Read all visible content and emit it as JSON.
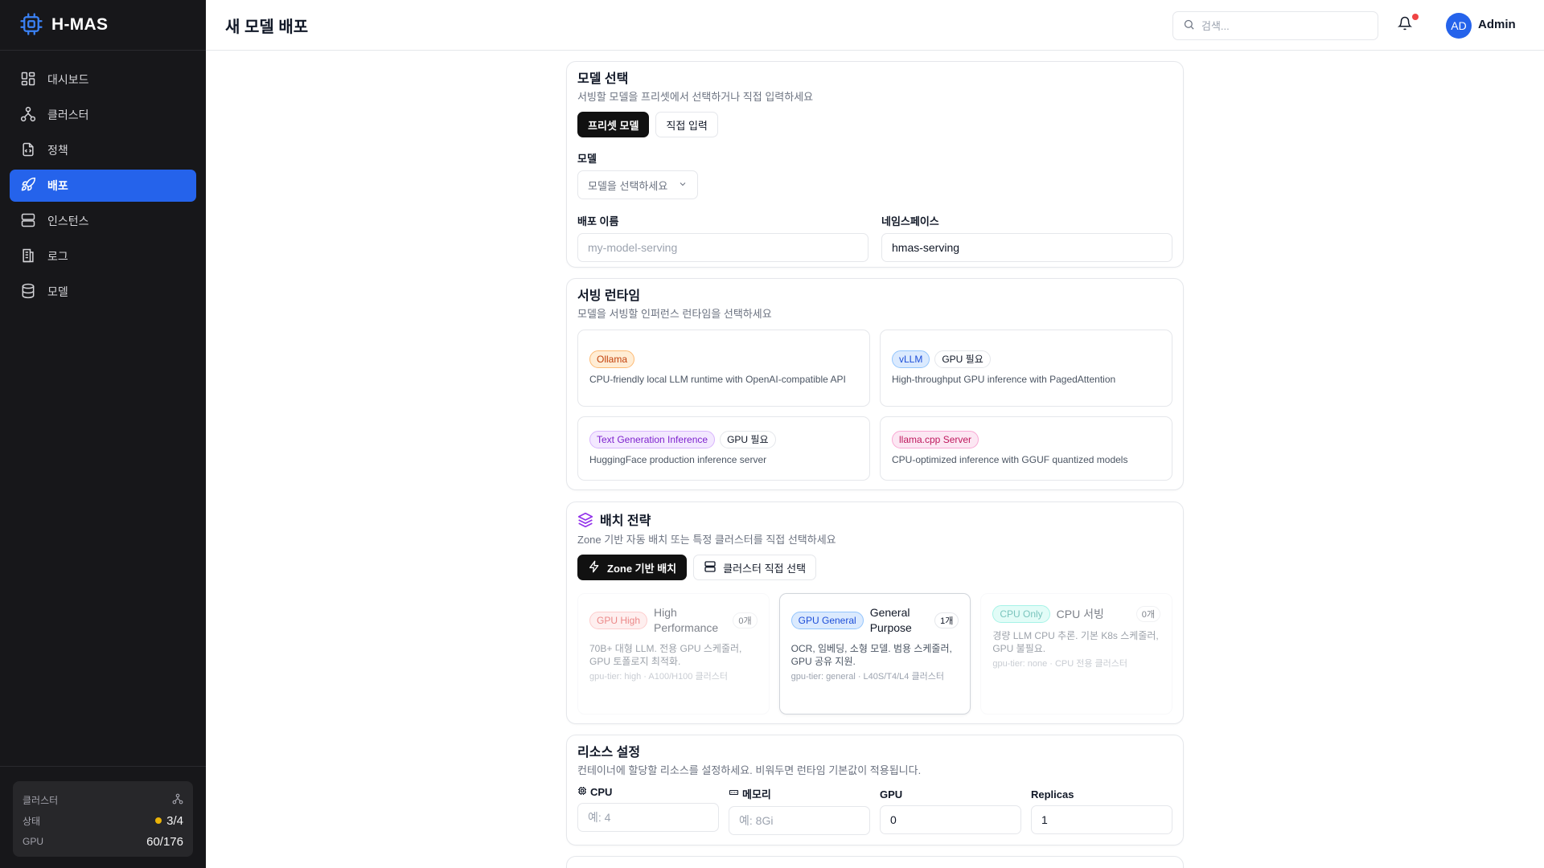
{
  "app": {
    "name": "H-MAS",
    "page_title": "새 모델 배포"
  },
  "sidebar": {
    "items": [
      {
        "label": "대시보드",
        "icon": "dashboard-icon"
      },
      {
        "label": "클러스터",
        "icon": "cluster-icon"
      },
      {
        "label": "정책",
        "icon": "policy-icon"
      },
      {
        "label": "배포",
        "icon": "rocket-icon",
        "active": true
      },
      {
        "label": "인스턴스",
        "icon": "server-icon"
      },
      {
        "label": "로그",
        "icon": "log-icon"
      },
      {
        "label": "모델",
        "icon": "database-icon"
      }
    ],
    "cluster_card": {
      "title": "클러스터",
      "status_label": "상태",
      "status_value": "3/4",
      "gpu_label": "GPU",
      "gpu_value": "60/176"
    }
  },
  "header": {
    "search_placeholder": "검색...",
    "avatar_initials": "AD",
    "user_name": "Admin"
  },
  "model_select": {
    "title": "모델 선택",
    "desc": "서빙할 모델을 프리셋에서 선택하거나 직접 입력하세요",
    "tabs": [
      "프리셋 모델",
      "직접 입력"
    ],
    "model_label": "모델",
    "model_placeholder": "모델을 선택하세요",
    "deploy_name_label": "배포 이름",
    "deploy_name_placeholder": "my-model-serving",
    "namespace_label": "네임스페이스",
    "namespace_value": "hmas-serving"
  },
  "runtime": {
    "title": "서빙 런타임",
    "desc": "모델을 서빙할 인퍼런스 런타임을 선택하세요",
    "gpu_required": "GPU 필요",
    "options": [
      {
        "name": "Ollama",
        "desc": "CPU-friendly local LLM runtime with OpenAI-compatible API"
      },
      {
        "name": "vLLM",
        "desc": "High-throughput GPU inference with PagedAttention"
      },
      {
        "name": "Text Generation Inference",
        "desc": "HuggingFace production inference server"
      },
      {
        "name": "llama.cpp Server",
        "desc": "CPU-optimized inference with GGUF quantized models"
      }
    ]
  },
  "placement": {
    "title": "배치 전략",
    "desc": "Zone 기반 자동 배치 또는 특정 클러스터를 직접 선택하세요",
    "tabs": [
      "Zone 기반 배치",
      "클러스터 직접 선택"
    ],
    "zones": [
      {
        "badge": "GPU High",
        "name": "High Performance",
        "count": "0개",
        "desc": "70B+ 대형 LLM. 전용 GPU 스케줄러, GPU 토폴로지 최적화.",
        "sub": "gpu-tier: high · A100/H100 클러스터"
      },
      {
        "badge": "GPU General",
        "name": "General Purpose",
        "count": "1개",
        "desc": "OCR, 임베딩, 소형 모델. 범용 스케줄러, GPU 공유 지원.",
        "sub": "gpu-tier: general · L40S/T4/L4 클러스터"
      },
      {
        "badge": "CPU Only",
        "name": "CPU 서빙",
        "count": "0개",
        "desc": "경량 LLM CPU 추론. 기본 K8s 스케줄러, GPU 불필요.",
        "sub": "gpu-tier: none · CPU 전용 클러스터"
      }
    ]
  },
  "resources": {
    "title": "리소스 설정",
    "desc": "컨테이너에 할당할 리소스를 설정하세요. 비워두면 런타임 기본값이 적용됩니다.",
    "cpu_label": "CPU",
    "cpu_placeholder": "예: 4",
    "memory_label": "메모리",
    "memory_placeholder": "예: 8Gi",
    "gpu_label": "GPU",
    "gpu_value": "0",
    "replicas_label": "Replicas",
    "replicas_value": "1"
  },
  "colors": {
    "accent": "#2563eb",
    "sidebar_bg": "#17171a",
    "notification": "#ef4444"
  }
}
